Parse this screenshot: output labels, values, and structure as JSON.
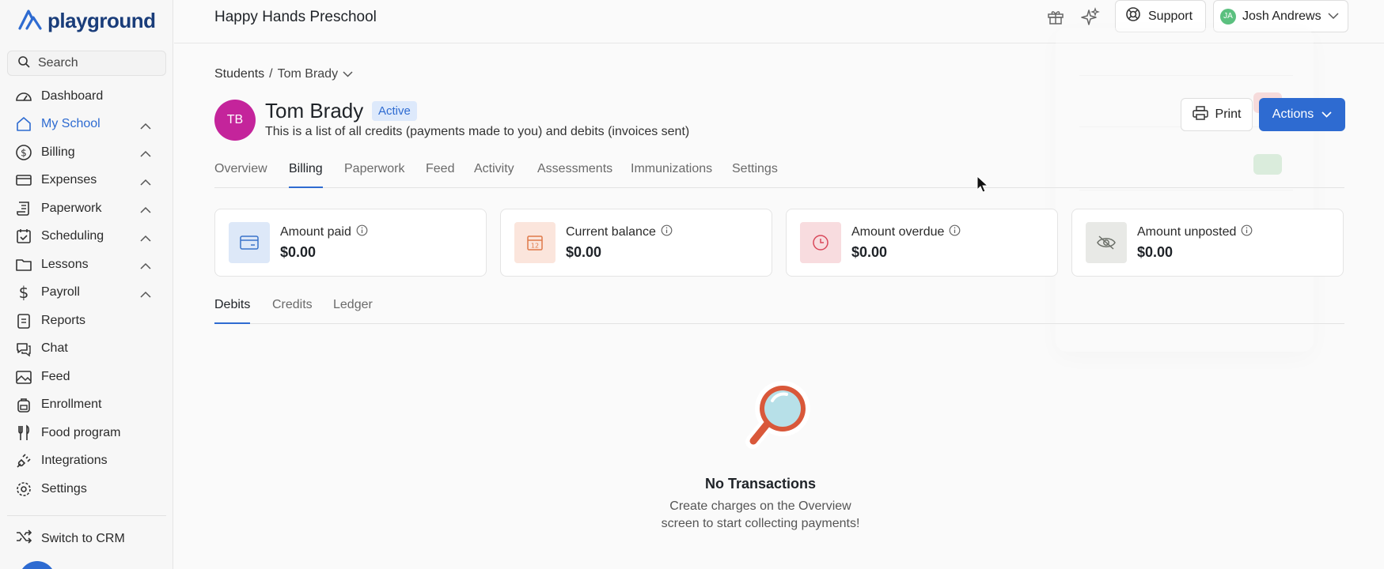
{
  "sidebar": {
    "logo": "playground",
    "search_label": "Search",
    "items": [
      {
        "label": "Dashboard"
      },
      {
        "label": "My School"
      },
      {
        "label": "Billing"
      },
      {
        "label": "Expenses"
      },
      {
        "label": "Paperwork"
      },
      {
        "label": "Scheduling"
      },
      {
        "label": "Lessons"
      },
      {
        "label": "Payroll"
      },
      {
        "label": "Reports"
      },
      {
        "label": "Chat"
      },
      {
        "label": "Feed"
      },
      {
        "label": "Enrollment"
      },
      {
        "label": "Food program"
      },
      {
        "label": "Integrations"
      },
      {
        "label": "Settings"
      }
    ],
    "switch_crm": "Switch to CRM"
  },
  "topbar": {
    "school_name": "Happy Hands Preschool",
    "support_label": "Support",
    "user_initials": "JA",
    "user_name": "Josh Andrews"
  },
  "breadcrumb": {
    "root": "Students",
    "separator": "/",
    "current": "Tom Brady"
  },
  "student": {
    "initials": "TB",
    "name": "Tom Brady",
    "status": "Active",
    "subtitle": "This is a list of all credits (payments made to you) and debits (invoices sent)"
  },
  "buttons": {
    "print": "Print",
    "actions": "Actions"
  },
  "tabs": [
    "Overview",
    "Billing",
    "Paperwork",
    "Feed",
    "Activity",
    "Assessments",
    "Immunizations",
    "Settings"
  ],
  "active_tab": "Billing",
  "cards": [
    {
      "label": "Amount paid",
      "value": "$0.00",
      "icon": "credit-card-icon",
      "color": "#dde8f8"
    },
    {
      "label": "Current balance",
      "value": "$0.00",
      "icon": "calendar-icon",
      "color": "#fbe5dc"
    },
    {
      "label": "Amount overdue",
      "value": "$0.00",
      "icon": "clock-icon",
      "color": "#f8dcdf"
    },
    {
      "label": "Amount unposted",
      "value": "$0.00",
      "icon": "eye-off-icon",
      "color": "#e8e9e6"
    }
  ],
  "subtabs": [
    "Debits",
    "Credits",
    "Ledger"
  ],
  "active_subtab": "Debits",
  "empty_state": {
    "title": "No Transactions",
    "line1": "Create charges on the Overview",
    "line2": "screen to start collecting payments!"
  },
  "colors": {
    "accent": "#2e6bd1",
    "avatar": "#c4249b",
    "user_avatar": "#5bc07f"
  }
}
